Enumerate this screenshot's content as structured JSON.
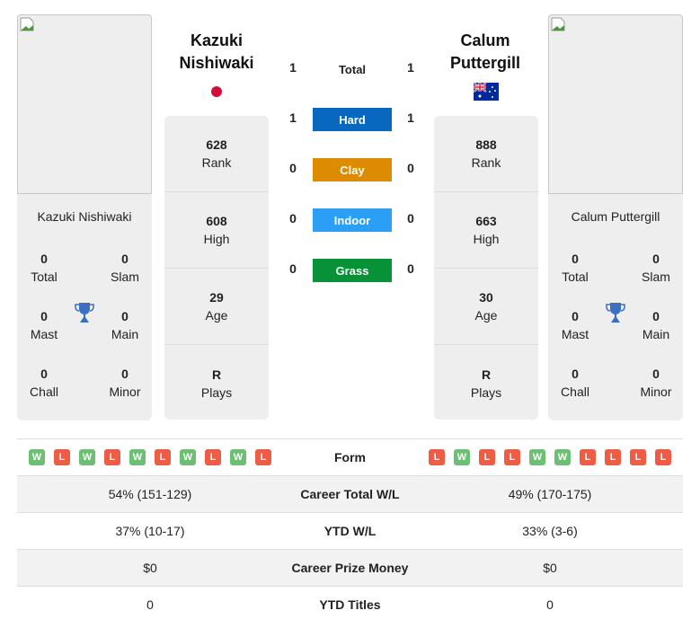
{
  "player1": {
    "name": "Kazuki Nishiwaki",
    "name_line1": "Kazuki",
    "name_line2": "Nishiwaki",
    "flag": "japan-flag",
    "titles": {
      "total": "0",
      "slam": "0",
      "mast": "0",
      "main": "0",
      "chall": "0",
      "minor": "0"
    },
    "rank": "628",
    "high": "608",
    "age": "29",
    "plays": "R",
    "form": [
      "W",
      "L",
      "W",
      "L",
      "W",
      "L",
      "W",
      "L",
      "W",
      "L"
    ],
    "career_wl": "54% (151-129)",
    "ytd_wl": "37% (10-17)",
    "prize": "$0",
    "ytd_titles": "0"
  },
  "player2": {
    "name": "Calum Puttergill",
    "name_line1": "Calum",
    "name_line2": "Puttergill",
    "flag": "australia-flag",
    "titles": {
      "total": "0",
      "slam": "0",
      "mast": "0",
      "main": "0",
      "chall": "0",
      "minor": "0"
    },
    "rank": "888",
    "high": "663",
    "age": "30",
    "plays": "R",
    "form": [
      "L",
      "W",
      "L",
      "L",
      "W",
      "W",
      "L",
      "L",
      "L",
      "L"
    ],
    "career_wl": "49% (170-175)",
    "ytd_wl": "33% (3-6)",
    "prize": "$0",
    "ytd_titles": "0"
  },
  "labels": {
    "total": "Total",
    "slam": "Slam",
    "mast": "Mast",
    "main": "Main",
    "chall": "Chall",
    "minor": "Minor",
    "rank": "Rank",
    "high": "High",
    "age": "Age",
    "plays": "Plays",
    "form": "Form",
    "career_wl": "Career Total W/L",
    "ytd_wl": "YTD W/L",
    "prize": "Career Prize Money",
    "ytd_titles": "YTD Titles"
  },
  "h2h": {
    "total": {
      "label": "Total",
      "p1": "1",
      "p2": "1"
    },
    "surfaces": [
      {
        "label": "Hard",
        "p1": "1",
        "p2": "1",
        "color": "#0868c0"
      },
      {
        "label": "Clay",
        "p1": "0",
        "p2": "0",
        "color": "#dd8b00"
      },
      {
        "label": "Indoor",
        "p1": "0",
        "p2": "0",
        "color": "#2b9ef5"
      },
      {
        "label": "Grass",
        "p1": "0",
        "p2": "0",
        "color": "#089238"
      }
    ]
  },
  "colors": {
    "win": "#6dbf73",
    "loss": "#ee5c45",
    "trophy": "#3b6fc0"
  }
}
